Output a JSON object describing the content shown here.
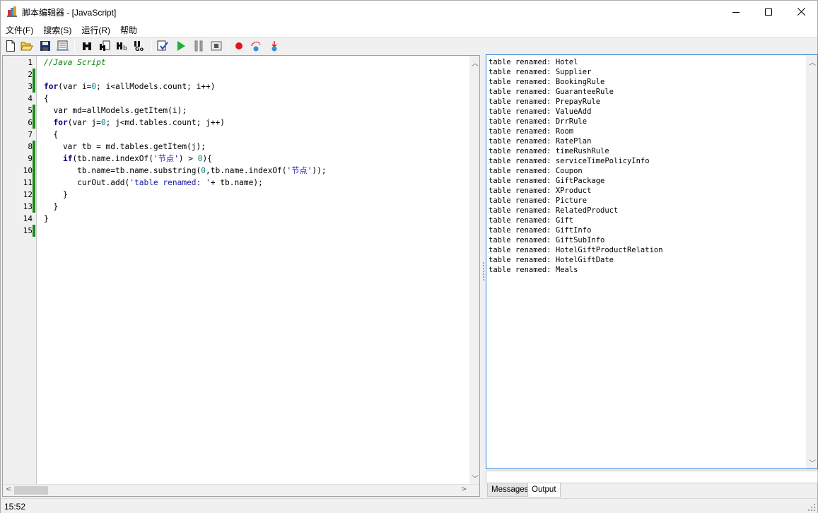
{
  "window": {
    "title": "脚本编辑器 - [JavaScript]"
  },
  "menu": [
    {
      "label": "文件(F)"
    },
    {
      "label": "搜索(S)"
    },
    {
      "label": "运行(R)"
    },
    {
      "label": "帮助"
    }
  ],
  "toolbar": {
    "buttons": [
      "new-file",
      "open-folder",
      "save",
      "print-preview",
      "find",
      "find-next",
      "replace",
      "goto",
      "check-syntax",
      "run",
      "pause",
      "stop",
      "breakpoint",
      "step-over",
      "step-into"
    ]
  },
  "editor": {
    "line_numbers": [
      "1",
      "2",
      "3",
      "4",
      "5",
      "6",
      "7",
      "8",
      "9",
      "10",
      "11",
      "12",
      "13",
      "14",
      "15"
    ],
    "changed_lines": [
      2,
      3,
      5,
      6,
      8,
      9,
      10,
      11,
      12,
      13,
      15
    ],
    "lines": [
      [
        {
          "t": "//Java Script",
          "c": "cm"
        }
      ],
      [],
      [
        {
          "t": "for",
          "c": "kw"
        },
        {
          "t": "(var i="
        },
        {
          "t": "0",
          "c": "nm"
        },
        {
          "t": "; i<allModels.count; i++)"
        }
      ],
      [
        {
          "t": "{"
        }
      ],
      [
        {
          "t": "  var md=allModels.getItem(i);"
        }
      ],
      [
        {
          "t": "  "
        },
        {
          "t": "for",
          "c": "kw"
        },
        {
          "t": "(var j="
        },
        {
          "t": "0",
          "c": "nm"
        },
        {
          "t": "; j<md.tables.count; j++)"
        }
      ],
      [
        {
          "t": "  {"
        }
      ],
      [
        {
          "t": "    var tb = md.tables.getItem(j);"
        }
      ],
      [
        {
          "t": "    "
        },
        {
          "t": "if",
          "c": "kw"
        },
        {
          "t": "(tb.name.indexOf("
        },
        {
          "t": "'节点'",
          "c": "st"
        },
        {
          "t": ") > "
        },
        {
          "t": "0",
          "c": "nm"
        },
        {
          "t": "){"
        }
      ],
      [
        {
          "t": "       tb.name=tb.name.substring("
        },
        {
          "t": "0",
          "c": "nm"
        },
        {
          "t": ",tb.name.indexOf("
        },
        {
          "t": "'节点'",
          "c": "st"
        },
        {
          "t": "));"
        }
      ],
      [
        {
          "t": "       curOut.add("
        },
        {
          "t": "'table renamed: '",
          "c": "st"
        },
        {
          "t": "+ tb.name);"
        }
      ],
      [
        {
          "t": "    }"
        }
      ],
      [
        {
          "t": "  }"
        }
      ],
      [
        {
          "t": "}"
        }
      ],
      []
    ]
  },
  "output": {
    "lines": [
      "table renamed: Hotel",
      "table renamed: Supplier",
      "table renamed: BookingRule",
      "table renamed: GuaranteeRule",
      "table renamed: PrepayRule",
      "table renamed: ValueAdd",
      "table renamed: DrrRule",
      "table renamed: Room",
      "table renamed: RatePlan",
      "table renamed: timeRushRule",
      "table renamed: serviceTimePolicyInfo",
      "table renamed: Coupon",
      "table renamed: GiftPackage",
      "table renamed: XProduct",
      "table renamed: Picture",
      "table renamed: RelatedProduct",
      "table renamed: Gift",
      "table renamed: GiftInfo",
      "table renamed: GiftSubInfo",
      "table renamed: HotelGiftProductRelation",
      "table renamed: HotelGiftDate",
      "table renamed: Meals"
    ]
  },
  "tabs": [
    {
      "label": "Messages"
    },
    {
      "label": "Output"
    }
  ],
  "status": {
    "cursor": "15:52"
  },
  "colors": {
    "keyword": "#00007f",
    "comment": "#007f00",
    "number": "#007f7f",
    "string": "#1a1aa6",
    "changed_marker": "#1b8a1b",
    "output_border": "#2b7fd6"
  }
}
